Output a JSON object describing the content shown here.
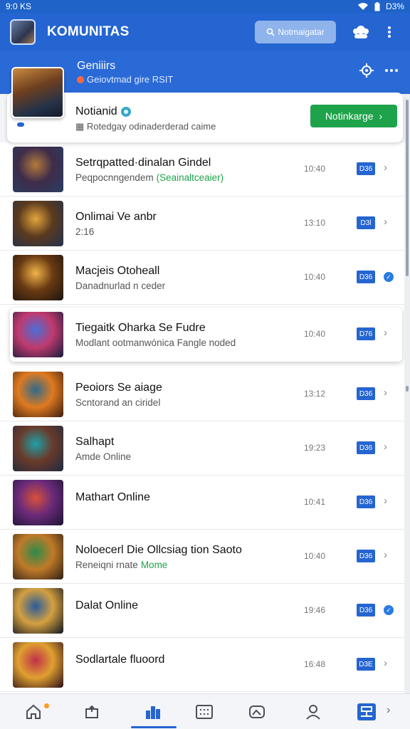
{
  "status_bar": {
    "time": "9:0 KS",
    "battery": "D3%"
  },
  "app_bar": {
    "title": "KOMUNITAS",
    "search_label": "Notmaigatar"
  },
  "community": {
    "name": "Geniiirs",
    "subtitle": "Geiovtmad gire RSIT"
  },
  "notification": {
    "title": "Notianid",
    "subtitle": "Rotedgay odinaderderad caime",
    "button_label": "Notinkarge"
  },
  "list": {
    "items": [
      {
        "title": "Setrqpatted·dinalan Gindel",
        "subtitle": "Peqpocnngendem",
        "subtitle_extra": "(Seainaltceaier)",
        "time": "10:40",
        "badge": "D36",
        "action": "chevron",
        "thumb": [
          "#b47a3c",
          "#3e2c4a",
          "#2a3e63"
        ]
      },
      {
        "title": "Onlimai Ve anbr",
        "subtitle": "2:16",
        "time": "13:10",
        "badge": "D3l",
        "action": "chevron",
        "thumb": [
          "#e4a53c",
          "#5a3a1e",
          "#21314f"
        ]
      },
      {
        "title": "Macjeis Otoheall",
        "subtitle": "Danadnurlad n ceder",
        "time": "10:40",
        "badge": "D36",
        "action": "check",
        "thumb": [
          "#f0b44a",
          "#6a3a12",
          "#1b1410"
        ]
      },
      {
        "title": "Tiegaitk Oharka Se Fudre",
        "subtitle": "Modlant ootmanwónica Fangle noded",
        "time": "10:40",
        "badge": "D76",
        "action": "chevron",
        "thumb": [
          "#4a6fd8",
          "#c03a6e",
          "#151c3c"
        ]
      },
      {
        "title": "Peoiors Se aiage",
        "subtitle": "Scntorand an ciridel",
        "time": "13:12",
        "badge": "D36",
        "action": "chevron",
        "thumb": [
          "#2f6a8a",
          "#e07a20",
          "#3a1e10"
        ]
      },
      {
        "title": "Salhapt",
        "subtitle": "Amde Online",
        "time": "19:23",
        "badge": "D36",
        "action": "chevron",
        "thumb": [
          "#1fa0a8",
          "#6a3a2a",
          "#1c2a40"
        ]
      },
      {
        "title": "Mathart Online",
        "subtitle": "",
        "time": "10:41",
        "badge": "D36",
        "action": "chevron",
        "thumb": [
          "#d8503a",
          "#6a2a7a",
          "#1a1430"
        ]
      },
      {
        "title": "Noloecerl Die Ollcsiag tion Saoto",
        "subtitle": "Reneiqni rnate",
        "subtitle_extra": "Mome",
        "time": "10:40",
        "badge": "D36",
        "action": "chevron",
        "thumb": [
          "#2e8a4a",
          "#c07a28",
          "#2a1e14"
        ]
      },
      {
        "title": "Dalat Online",
        "subtitle": "",
        "time": "19:46",
        "badge": "D36",
        "action": "check",
        "thumb": [
          "#2a5a9a",
          "#d4a040",
          "#0c1420"
        ]
      },
      {
        "title": "Sodlartale fluoord",
        "subtitle": "",
        "time": "16:48",
        "badge": "D3E",
        "action": "chevron",
        "thumb": [
          "#c0304a",
          "#e0a030",
          "#2a0e18"
        ]
      }
    ]
  },
  "bottom_nav": {
    "items": [
      "home-icon",
      "share-icon",
      "community-icon",
      "grid-icon",
      "photo-icon",
      "profile-icon",
      "board-icon"
    ],
    "active_index": 2
  },
  "colors": {
    "primary": "#2565d1",
    "green": "#1ea34a",
    "badge": "#2565d1"
  }
}
